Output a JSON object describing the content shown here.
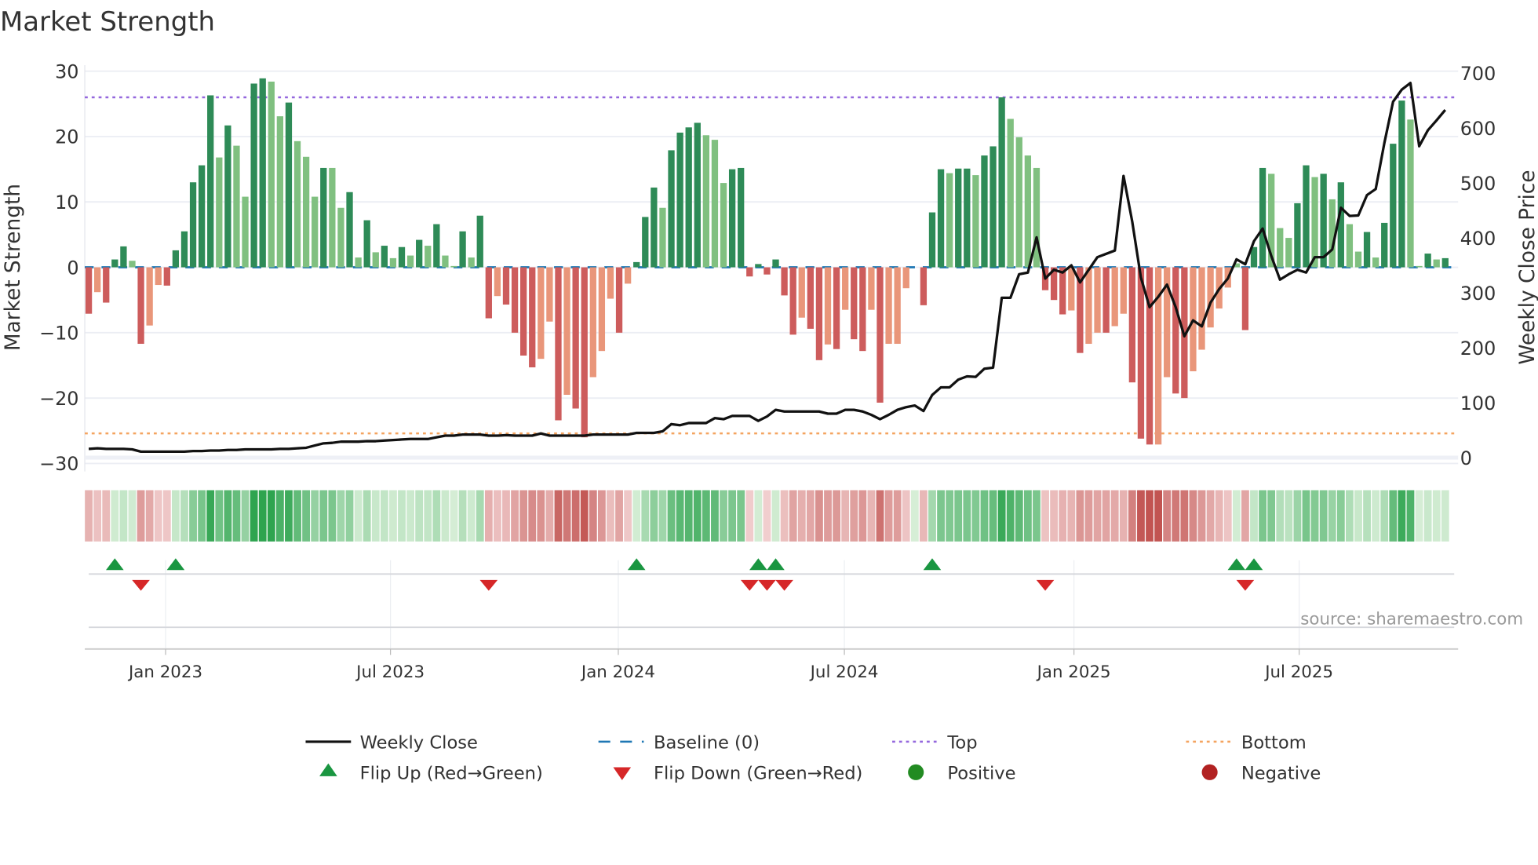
{
  "chart_data": {
    "type": "bar",
    "title": "Market Strength",
    "ylabel": "Market Strength",
    "y2label": "Weekly Close Price",
    "ylim": [
      -31,
      31
    ],
    "y2lim": [
      -12,
      710
    ],
    "yticks": [
      30,
      20,
      10,
      0,
      -10,
      -20,
      -30
    ],
    "y2ticks": [
      700,
      600,
      500,
      400,
      300,
      200,
      100,
      0
    ],
    "xticks": [
      {
        "label": "Jan 2023",
        "week": 9.84
      },
      {
        "label": "Jul 2023",
        "week": 35.7
      },
      {
        "label": "Jan 2024",
        "week": 61.9
      },
      {
        "label": "Jul 2024",
        "week": 87.9
      },
      {
        "label": "Jan 2025",
        "week": 114.3
      },
      {
        "label": "Jul 2025",
        "week": 140.2
      }
    ],
    "x_start": "2022-10-31",
    "x_interval_days": 7,
    "top_level": 26,
    "bottom_level": -25.4,
    "grid": true,
    "series_strength": [
      -7.1,
      -3.8,
      -5.4,
      1.2,
      3.2,
      1.0,
      -11.7,
      -8.9,
      -2.7,
      -2.8,
      2.6,
      5.5,
      13,
      15.6,
      26.3,
      16.8,
      21.7,
      18.6,
      10.8,
      28.1,
      28.9,
      28.4,
      23.1,
      25.2,
      19.3,
      16.9,
      10.8,
      15.2,
      15.2,
      9.1,
      11.5,
      1.5,
      7.2,
      2.3,
      3.3,
      1.4,
      3.1,
      1.8,
      4.2,
      3.3,
      6.6,
      1.8,
      0.2,
      5.5,
      1.5,
      7.9,
      -7.8,
      -4.4,
      -5.7,
      -10,
      -13.5,
      -15.3,
      -14,
      -8.3,
      -23.4,
      -19.5,
      -21.6,
      -26,
      -16.8,
      -12.8,
      -4.8,
      -10,
      -2.5,
      0.8,
      7.7,
      12.2,
      9.1,
      17.9,
      20.6,
      21.4,
      22.1,
      20.2,
      19.5,
      12.9,
      15,
      15.2,
      -1.4,
      0.5,
      -1.1,
      1.2,
      -4.3,
      -10.3,
      -7.7,
      -9.4,
      -14.2,
      -11.8,
      -12.5,
      -6.5,
      -11,
      -12.8,
      -6.5,
      -20.7,
      -11.7,
      -11.7,
      -3.2,
      0,
      -5.8,
      8.4,
      15,
      14.4,
      15.1,
      15.1,
      14.1,
      17.1,
      18.5,
      26,
      22.7,
      19.9,
      17.1,
      15.2,
      -3.5,
      -5,
      -7.2,
      -6.6,
      -13.1,
      -11.7,
      -10,
      -10,
      -9,
      -7.1,
      -17.6,
      -26.2,
      -27.1,
      -27.1,
      -16.8,
      -19.3,
      -20,
      -15.9,
      -12.6,
      -9.2,
      -6.3,
      -3.1,
      0.6,
      -9.6,
      3.1,
      15.2,
      14.3,
      6,
      4.5,
      9.8,
      15.6,
      13.8,
      14.3,
      10.4,
      13,
      6.6,
      2.4,
      5.4,
      1.5,
      6.8,
      18.9,
      25.5,
      22.6,
      0.2,
      2.1,
      1.2,
      1.4
    ],
    "series_shade": [
      "d",
      "l",
      "d",
      "d",
      "d",
      "l",
      "d",
      "l",
      "l",
      "d",
      "d",
      "d",
      "d",
      "d",
      "d",
      "l",
      "d",
      "l",
      "l",
      "d",
      "d",
      "l",
      "l",
      "d",
      "l",
      "l",
      "l",
      "d",
      "l",
      "l",
      "d",
      "l",
      "d",
      "l",
      "d",
      "l",
      "d",
      "l",
      "d",
      "l",
      "d",
      "l",
      "l",
      "d",
      "l",
      "d",
      "d",
      "l",
      "d",
      "d",
      "d",
      "d",
      "l",
      "l",
      "d",
      "l",
      "d",
      "d",
      "l",
      "l",
      "l",
      "d",
      "l",
      "d",
      "d",
      "d",
      "l",
      "d",
      "d",
      "d",
      "d",
      "l",
      "l",
      "l",
      "d",
      "d",
      "d",
      "d",
      "d",
      "d",
      "d",
      "d",
      "l",
      "d",
      "d",
      "l",
      "d",
      "l",
      "d",
      "d",
      "l",
      "d",
      "l",
      "l",
      "l",
      "d",
      "d",
      "d",
      "d",
      "l",
      "d",
      "d",
      "l",
      "d",
      "d",
      "d",
      "l",
      "l",
      "l",
      "l",
      "d",
      "d",
      "d",
      "l",
      "d",
      "l",
      "l",
      "d",
      "l",
      "l",
      "d",
      "d",
      "d",
      "l",
      "l",
      "d",
      "d",
      "l",
      "l",
      "l",
      "l",
      "l",
      "l",
      "d",
      "d",
      "d",
      "l",
      "l",
      "l",
      "d",
      "d",
      "l",
      "d",
      "l",
      "d",
      "l",
      "l",
      "d",
      "l",
      "d",
      "d",
      "d",
      "l",
      "l",
      "d",
      "l",
      "d"
    ],
    "series_close": [
      16,
      17,
      16,
      16,
      16,
      15,
      11,
      11,
      11,
      11,
      11,
      11,
      12,
      12,
      13,
      13,
      14,
      14,
      15,
      15,
      15,
      15,
      16,
      16,
      17,
      18,
      22,
      26,
      27,
      29,
      29,
      29,
      30,
      30,
      31,
      32,
      33,
      34,
      34,
      34,
      37,
      40,
      40,
      42,
      42,
      42,
      40,
      40,
      41,
      40,
      40,
      40,
      44,
      40,
      40,
      40,
      40,
      40,
      42,
      42,
      42,
      42,
      42,
      45,
      45,
      45,
      48,
      61,
      59,
      63,
      63,
      63,
      72,
      70,
      76,
      76,
      76,
      67,
      75,
      87,
      84,
      84,
      84,
      84,
      84,
      80,
      80,
      87,
      87,
      84,
      78,
      70,
      78,
      87,
      92,
      95,
      85,
      114,
      128,
      128,
      142,
      148,
      147,
      162,
      164,
      291,
      291,
      334,
      337,
      401,
      326,
      342,
      337,
      350,
      319,
      342,
      365,
      371,
      377,
      513,
      430,
      328,
      274,
      293,
      315,
      274,
      221,
      250,
      239,
      282,
      307,
      326,
      361,
      352,
      394,
      417,
      367,
      324,
      334,
      342,
      337,
      365,
      365,
      379,
      455,
      440,
      441,
      478,
      489,
      573,
      648,
      670,
      682,
      567,
      596,
      614,
      633
    ],
    "flip_up_weeks": [
      4,
      11,
      64,
      78,
      80,
      98,
      133,
      135
    ],
    "flip_down_weeks": [
      7,
      47,
      77,
      79,
      81,
      111,
      134
    ],
    "legend": {
      "weekly_close": "Weekly Close",
      "baseline": "Baseline (0)",
      "top": "Top",
      "bottom": "Bottom",
      "flip_up": "Flip Up (Red→Green)",
      "flip_down": "Flip Down (Green→Red)",
      "positive": "Positive",
      "negative": "Negative"
    },
    "source": "source: sharemaestro.com"
  },
  "colors": {
    "pos_dark": "#2e8b57",
    "pos_light": "#80c080",
    "neg_dark": "#cd5c5c",
    "neg_light": "#e9967a",
    "line": "#111111",
    "baseline": "#1f77b4",
    "top": "#9467dd",
    "bottom": "#f4a460",
    "flip_up": "#1a9641",
    "flip_down": "#d62728",
    "positive_dot": "#228b22",
    "negative_dot": "#b22222"
  }
}
